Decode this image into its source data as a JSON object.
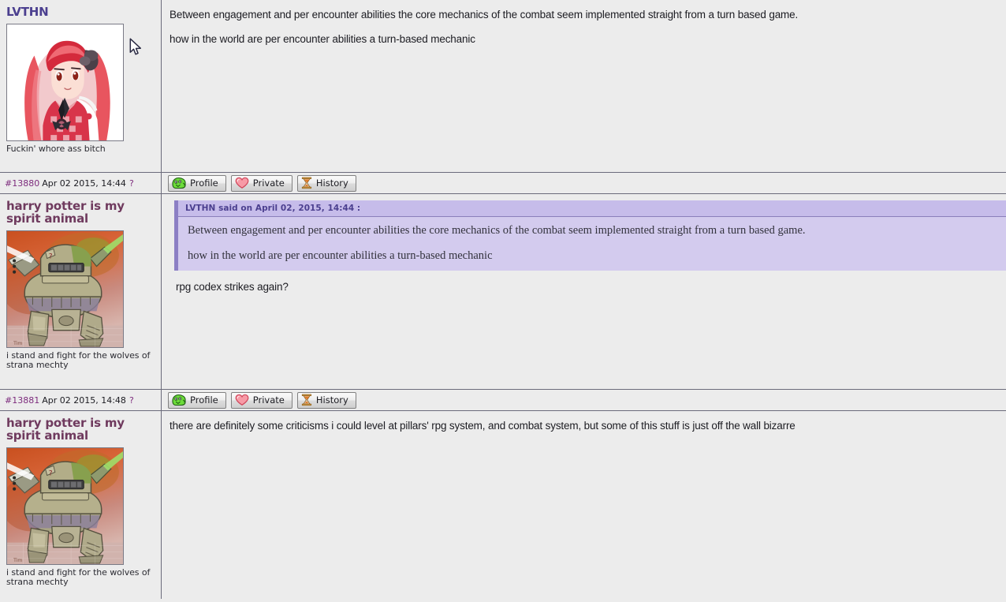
{
  "buttons": {
    "profile": "Profile",
    "private": "Private",
    "history": "History"
  },
  "icons": {
    "profile": "frog-icon",
    "private": "heart-icon",
    "history": "hourglass-icon",
    "cursor": "mouse-pointer-icon"
  },
  "colors": {
    "page_bg": "#ececec",
    "username_purple": "#4b3f8f",
    "username_maroon": "#6f3a5e",
    "postid_link": "#7d2b7d",
    "quote_bg": "#d3cbee",
    "quote_head_bg": "#c6bcea",
    "quote_border": "#8c7fc4",
    "divider": "#6b6b7b"
  },
  "posts": [
    {
      "id": "post-1",
      "username": "LVTHN",
      "username_color": "purple",
      "avatar": "anime-girl-red-hair-avatar",
      "tagline": "Fuckin' whore ass bitch",
      "paragraphs": [
        "Between engagement and per encounter abilities the core mechanics of the combat seem implemented straight from a turn based game.",
        "how in the world are per encounter abilities a turn-based mechanic"
      ],
      "quote": null,
      "footer": {
        "post_number": "#13880",
        "timestamp": "Apr 02 2015, 14:44",
        "question_mark": "?"
      }
    },
    {
      "id": "post-2",
      "username": "harry potter is my spirit animal",
      "username_color": "maroon",
      "avatar": "mech-walker-robot-avatar",
      "tagline": "i stand and fight for the wolves of strana mechty",
      "quote": {
        "header": "LVTHN said on April 02, 2015, 14:44 :",
        "paragraphs": [
          "Between engagement and per encounter abilities the core mechanics of the combat seem implemented straight from a turn based game.",
          "how in the world are per encounter abilities a turn-based mechanic"
        ]
      },
      "paragraphs": [
        "rpg codex strikes again?"
      ],
      "footer": {
        "post_number": "#13881",
        "timestamp": "Apr 02 2015, 14:48",
        "question_mark": "?"
      }
    },
    {
      "id": "post-3",
      "username": "harry potter is my spirit animal",
      "username_color": "maroon",
      "avatar": "mech-walker-robot-avatar",
      "tagline": "i stand and fight for the wolves of strana mechty",
      "quote": null,
      "paragraphs": [
        "there are definitely some criticisms i could level at pillars' rpg system, and combat system, but some of this stuff is just off the wall bizarre"
      ],
      "footer": null
    }
  ]
}
